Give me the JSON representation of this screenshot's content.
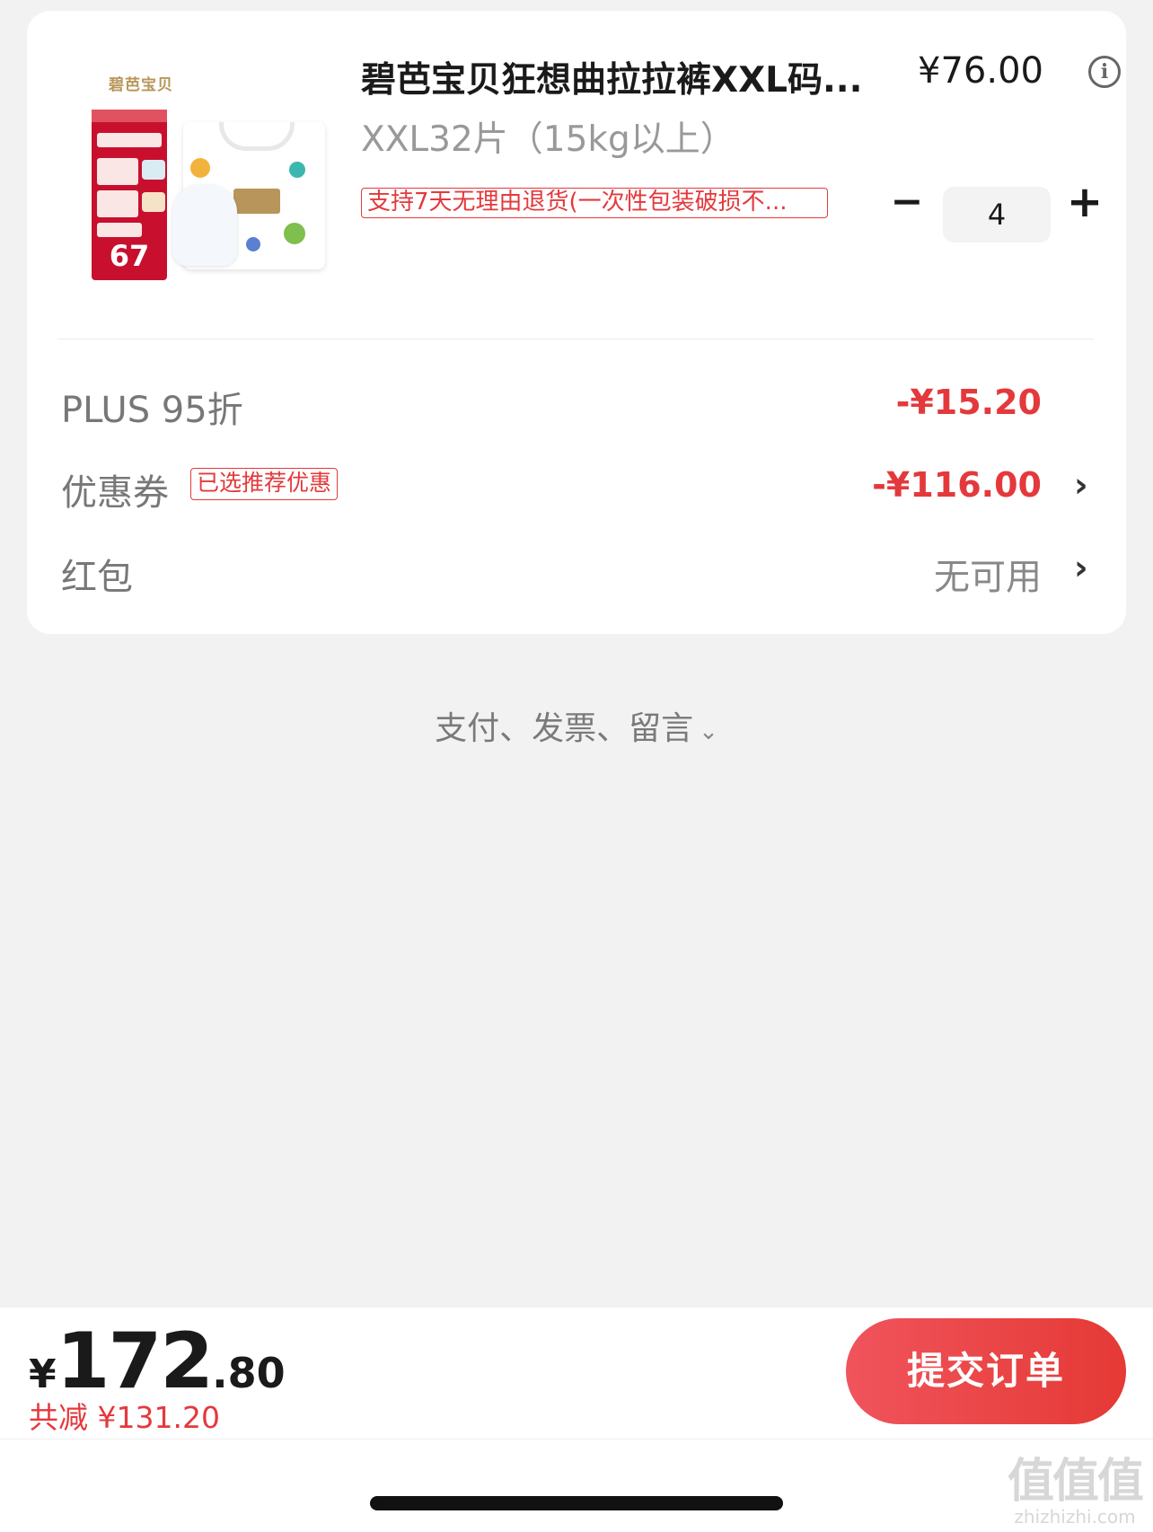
{
  "product": {
    "title": "碧芭宝贝狂想曲拉拉裤XXL码...",
    "price": "¥76.00",
    "spec": "XXL32片（15kg以上）",
    "return_tag": "支持7天无理由退货(一次性包装破损不...",
    "quantity": "4",
    "image": {
      "brand": "碧芭宝贝",
      "poster_price": "67"
    }
  },
  "discounts": {
    "plus": {
      "label": "PLUS 95折",
      "value": "-¥15.20"
    },
    "coupon": {
      "label": "优惠券",
      "tag": "已选推荐优惠",
      "value": "-¥116.00"
    },
    "red_packet": {
      "label": "红包",
      "value": "无可用"
    }
  },
  "more": {
    "label": "支付、发票、留言",
    "caret": "⌄"
  },
  "footer": {
    "currency": "¥",
    "total_int": "172",
    "total_dec": ".80",
    "saving": "共减 ¥131.20",
    "submit_label": "提交订单"
  },
  "watermark": {
    "big": "值值值",
    "small": "zhizhizhi.com"
  },
  "colors": {
    "accent": "#e4393c",
    "background": "#f2f2f2"
  }
}
